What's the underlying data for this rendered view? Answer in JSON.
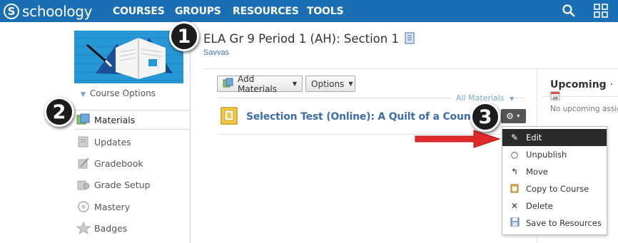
{
  "nav": {
    "logo_text": "schoology",
    "logo_mark": "S",
    "items": [
      "COURSES",
      "GROUPS",
      "RESOURCES",
      "TOOLS"
    ],
    "search_icon": "search-icon",
    "apps_icon": "grid-icon"
  },
  "course": {
    "options_label": "Course Options",
    "title": "ELA Gr 9 Period 1 (AH): Section 1",
    "subtitle": "Savvas"
  },
  "sidebar": {
    "items": [
      {
        "label": "Materials",
        "icon": "materials-icon",
        "active": true
      },
      {
        "label": "Updates",
        "icon": "updates-icon"
      },
      {
        "label": "Gradebook",
        "icon": "gradebook-icon"
      },
      {
        "label": "Grade Setup",
        "icon": "grade-setup-icon"
      },
      {
        "label": "Mastery",
        "icon": "mastery-icon"
      },
      {
        "label": "Badges",
        "icon": "badges-icon"
      }
    ]
  },
  "toolbar": {
    "add_materials": "Add Materials",
    "options": "Options",
    "filter": "All Materials"
  },
  "material": {
    "title": "Selection Test (Online): A Quilt of a Country"
  },
  "upcoming": {
    "title": "Upcoming",
    "empty": "No upcoming assignments or events"
  },
  "menu": {
    "items": [
      {
        "label": "Edit",
        "icon": "pencil-icon",
        "glyph": "✎",
        "highlighted": true
      },
      {
        "label": "Unpublish",
        "icon": "circle-icon",
        "glyph": "○"
      },
      {
        "label": "Move",
        "icon": "move-icon",
        "glyph": "↰"
      },
      {
        "label": "Copy to Course",
        "icon": "copy-icon",
        "glyph": "📋"
      },
      {
        "label": "Delete",
        "icon": "delete-icon",
        "glyph": "✕"
      },
      {
        "label": "Save to Resources",
        "icon": "save-icon",
        "glyph": "🖫"
      }
    ]
  },
  "callouts": [
    "1",
    "2",
    "3"
  ],
  "colors": {
    "nav_bg": "#1a6fb4",
    "link": "#3d6ea9",
    "arrow": "#e02a2a",
    "menu_highlight": "#2a2a2a"
  }
}
